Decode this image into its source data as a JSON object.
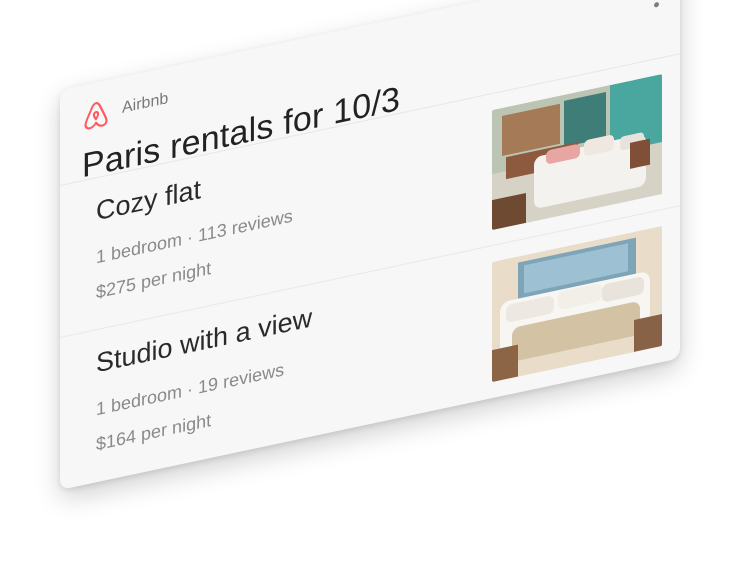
{
  "card": {
    "brand_name": "Airbnb",
    "title": "Paris rentals for 10/3",
    "more_icon": "more-vert-icon",
    "listings": [
      {
        "name": "Cozy flat",
        "details": "1 bedroom · 113 reviews",
        "price": "$275 per night",
        "image_icon": "bedroom-photo-1"
      },
      {
        "name": "Studio with a view",
        "details": "1 bedroom · 19 reviews",
        "price": "$164 per night",
        "image_icon": "bedroom-photo-2"
      }
    ]
  },
  "colors": {
    "brand": "#ff5a5f",
    "text_primary": "#222222",
    "text_secondary": "#8a8a8a"
  }
}
